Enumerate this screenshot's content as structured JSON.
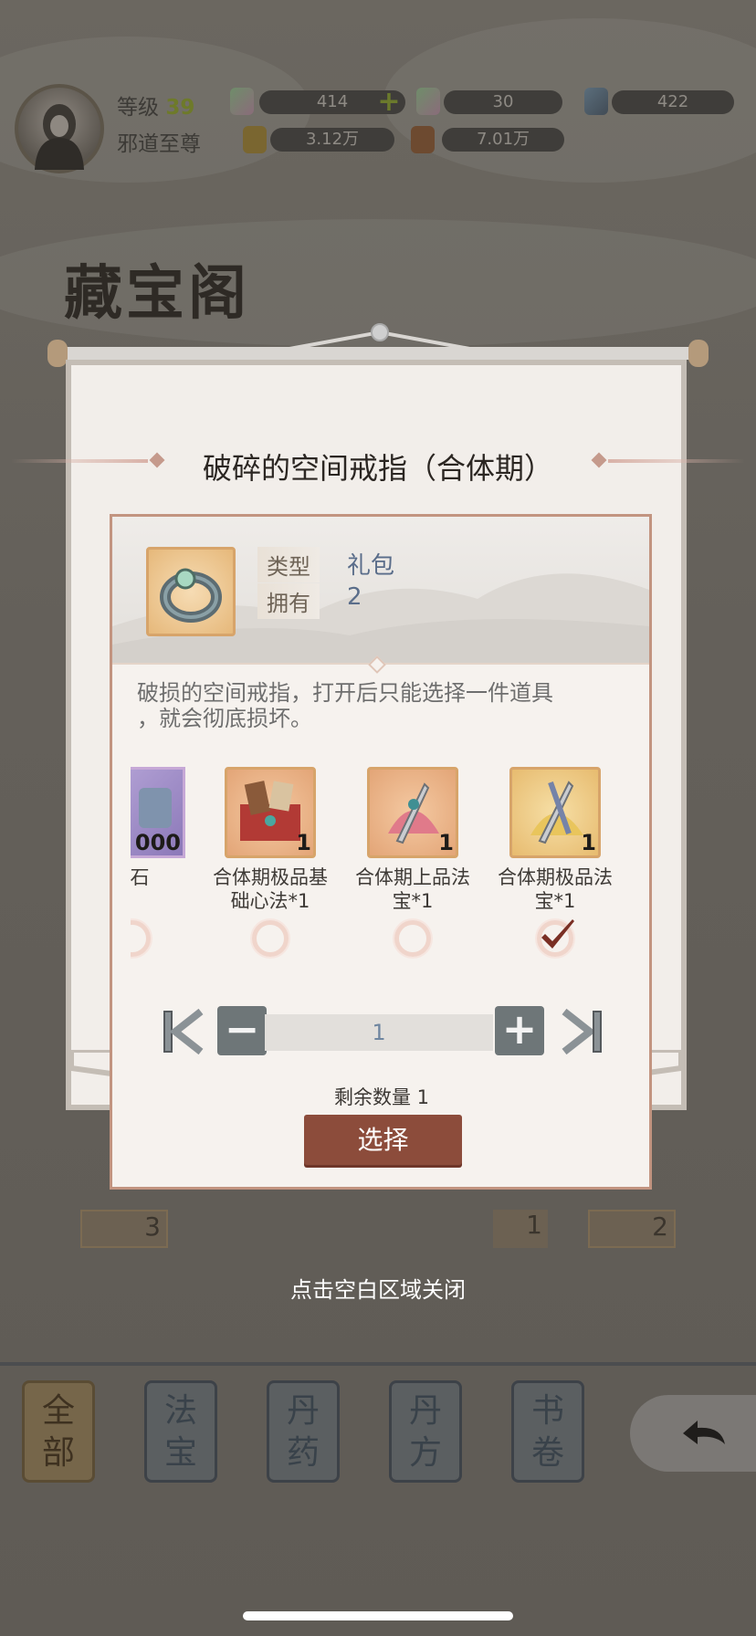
{
  "hud": {
    "level_label": "等级",
    "level_value": "39",
    "player_title": "邪道至尊",
    "resources": [
      "414",
      "30",
      "422"
    ],
    "currencies": [
      "3.12万",
      "7.01万"
    ]
  },
  "page_title": "藏宝阁",
  "bg_slots": [
    "3",
    "1",
    "2"
  ],
  "modal": {
    "title": "破碎的空间戒指（合体期）",
    "type_label": "类型",
    "type_value": "礼包",
    "own_label": "拥有",
    "own_value": "2",
    "description_line1": "破损的空间戒指，打开后只能选择一件道具",
    "description_line2": "，就会彻底损坏。",
    "rewards": [
      {
        "name_line1": "石",
        "name_line2": "",
        "count": "000",
        "selected": false
      },
      {
        "name_line1": "合体期极品基",
        "name_line2": "础心法*1",
        "count": "1",
        "selected": false
      },
      {
        "name_line1": "合体期上品法",
        "name_line2": "宝*1",
        "count": "1",
        "selected": false
      },
      {
        "name_line1": "合体期极品法",
        "name_line2": "宝*1",
        "count": "1",
        "selected": true
      }
    ],
    "quantity": "1",
    "minus_symbol": "−",
    "plus_symbol": "+",
    "remaining": "剩余数量 1",
    "choose_label": "选择"
  },
  "close_hint": "点击空白区域关闭",
  "tabs": [
    {
      "line1": "全",
      "line2": "部",
      "selected": true
    },
    {
      "line1": "法",
      "line2": "宝",
      "selected": false
    },
    {
      "line1": "丹",
      "line2": "药",
      "selected": false
    },
    {
      "line1": "丹",
      "line2": "方",
      "selected": false
    },
    {
      "line1": "书",
      "line2": "卷",
      "selected": false
    }
  ],
  "colors": {
    "accent_button": "#8c4c3b",
    "check": "#7a2f24",
    "value_text": "#5a6d8a",
    "border_frame": "#c29480"
  }
}
